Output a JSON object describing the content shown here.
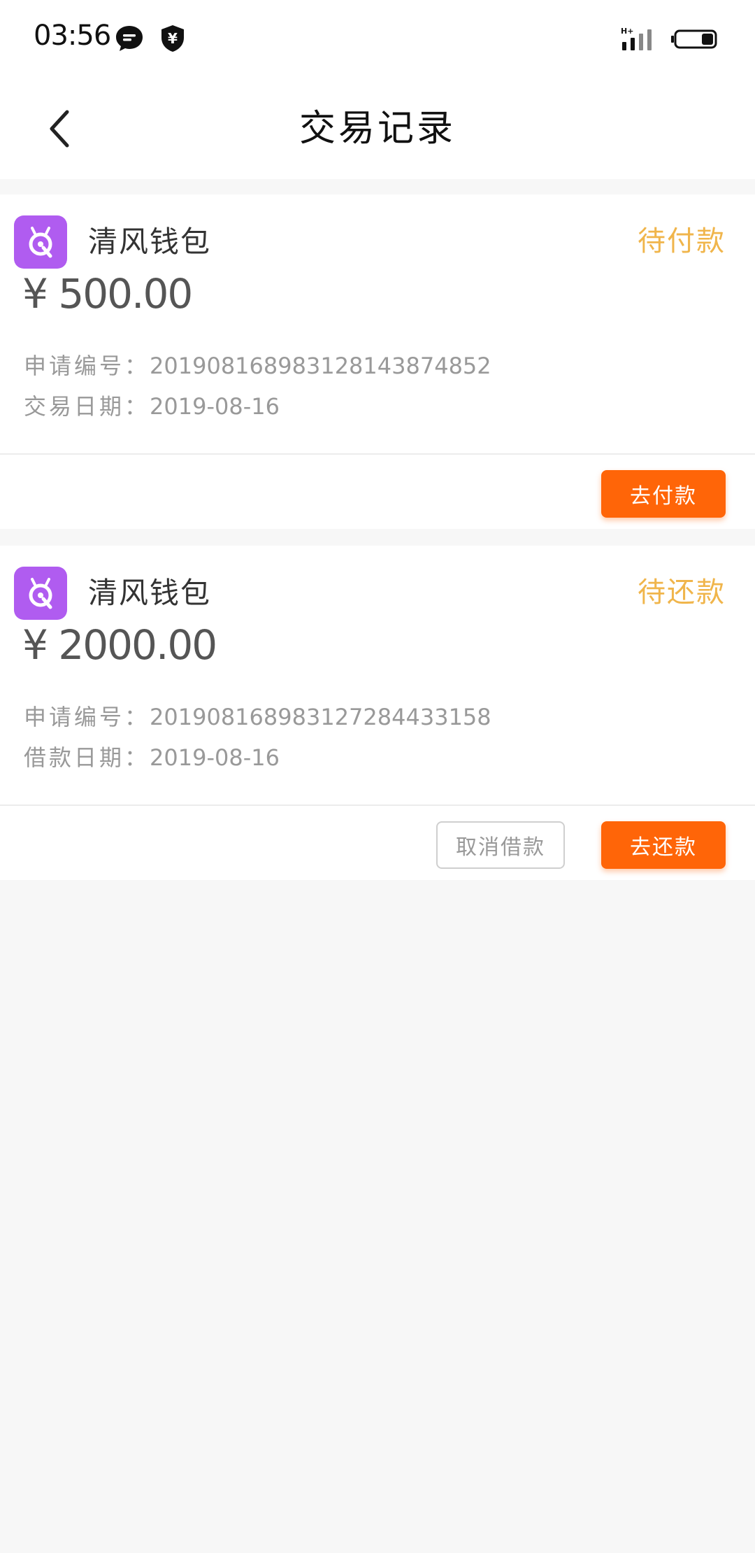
{
  "status_bar": {
    "time": "03:56",
    "icons": [
      "message-icon",
      "wallet-shield-icon",
      "signal-icon",
      "battery-icon"
    ]
  },
  "header": {
    "title": "交易记录",
    "back_icon": "chevron-left-icon"
  },
  "records": [
    {
      "app_name": "清风钱包",
      "status": "待付款",
      "amount": "¥ 500.00",
      "row1_label": "申请编号：",
      "row1_value": "20190816898312814387485​2",
      "row2_label": "交易日期：",
      "row2_value": "2019-08-16",
      "primary_button": "去付款"
    },
    {
      "app_name": "清风钱包",
      "status": "待还款",
      "amount": "¥ 2000.00",
      "row1_label": "申请编号：",
      "row1_value": "201908168983127284433158",
      "row2_label": "借款日期：",
      "row2_value": "2019-08-16",
      "secondary_button": "取消借款",
      "primary_button": "去还款"
    }
  ],
  "colors": {
    "accent": "#ff6508",
    "status_text": "#f0b54b",
    "app_icon_bg": "#b05cf0",
    "page_bg": "#f7f7f7"
  }
}
